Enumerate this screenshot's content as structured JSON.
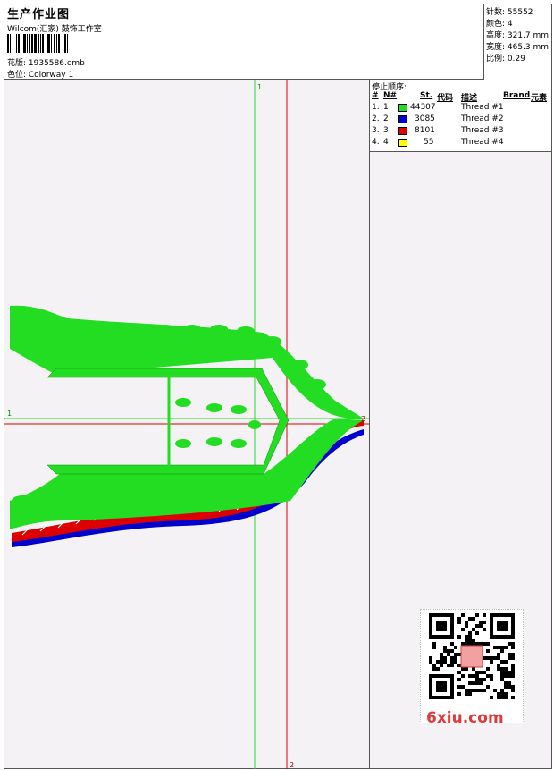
{
  "header": {
    "title": "生产作业图",
    "company": "Wilcom(汇家) 鼓饰工作室",
    "design_label": "花版: 1935586.emb",
    "colorway_label": "色位: Colorway 1"
  },
  "stats": {
    "stitches": "针数: 55552",
    "colors": "颜色: 4",
    "height": "高度: 321.7 mm",
    "width": "宽度: 465.3 mm",
    "scale": "比例: 0.29"
  },
  "stop_sequence": {
    "title": "停止顺序:",
    "headers": {
      "num": "#",
      "n": "N#",
      "st": "St.",
      "code": "代码",
      "desc": "描述",
      "brand": "Brand",
      "element": "元素"
    },
    "rows": [
      {
        "num": "1.",
        "n": "1",
        "color": "#22dd22",
        "st": "44307",
        "desc": "Thread #1"
      },
      {
        "num": "2.",
        "n": "2",
        "color": "#0000cc",
        "st": "3085",
        "desc": "Thread #2"
      },
      {
        "num": "3.",
        "n": "3",
        "color": "#dd0000",
        "st": "8101",
        "desc": "Thread #3"
      },
      {
        "num": "4.",
        "n": "4",
        "color": "#ffff00",
        "st": "55",
        "desc": "Thread #4"
      }
    ]
  },
  "canvas": {
    "guide_label_1_top": "1",
    "guide_label_1_left": "1",
    "guide_label_2_bottom": "2",
    "guide_label_2_right": "2",
    "guide_color_green": "#22dd22",
    "guide_color_red": "#dd0000"
  },
  "watermark": {
    "brand": "6xiu.com",
    "icon": "qr-code-icon"
  }
}
